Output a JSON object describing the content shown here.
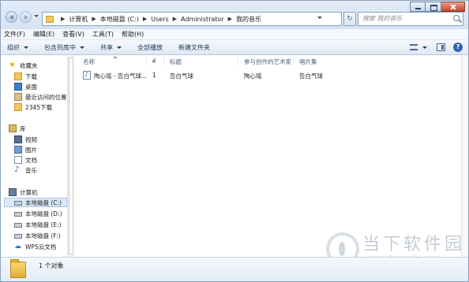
{
  "window": {
    "breadcrumb": [
      "计算机",
      "本地磁盘 (C:)",
      "Users",
      "Administrator",
      "我的音乐"
    ],
    "search_placeholder": "搜索 我的音乐"
  },
  "menu": [
    "文件(F)",
    "编辑(E)",
    "查看(V)",
    "工具(T)",
    "帮助(H)"
  ],
  "commands": {
    "organize": "组织",
    "include_library": "包含到库中",
    "share": "共享",
    "play_all": "全部播放",
    "new_folder": "新建文件夹"
  },
  "nav": {
    "favorites": "收藏夹",
    "downloads": "下载",
    "desktop": "桌面",
    "recent": "最近访问的位置",
    "dl2345": "2345下载",
    "libraries": "库",
    "videos": "视频",
    "pictures": "图片",
    "documents": "文档",
    "music": "音乐",
    "computer": "计算机",
    "drive_c": "本地磁盘 (C:)",
    "drive_d": "本地磁盘 (D:)",
    "drive_e": "本地磁盘 (E:)",
    "drive_f": "本地磁盘 (F:)",
    "wps": "WPS云文档"
  },
  "columns": {
    "name": "名称",
    "number": "#",
    "title": "标题",
    "artist": "参与创作的艺术家",
    "album": "唱片集"
  },
  "files": [
    {
      "name": "陶心瑶 - 告白气球...",
      "number": "1",
      "title": "告白气球",
      "artist": "陶心瑶",
      "album": "告白气球"
    }
  ],
  "status": {
    "count": "1 个对象"
  },
  "watermark": {
    "brand": "当下软件园",
    "url": "www.downxia.com"
  },
  "icons": {
    "favorites": "star-icon",
    "music": "music-note-icon",
    "wps": "cloud-icon"
  }
}
